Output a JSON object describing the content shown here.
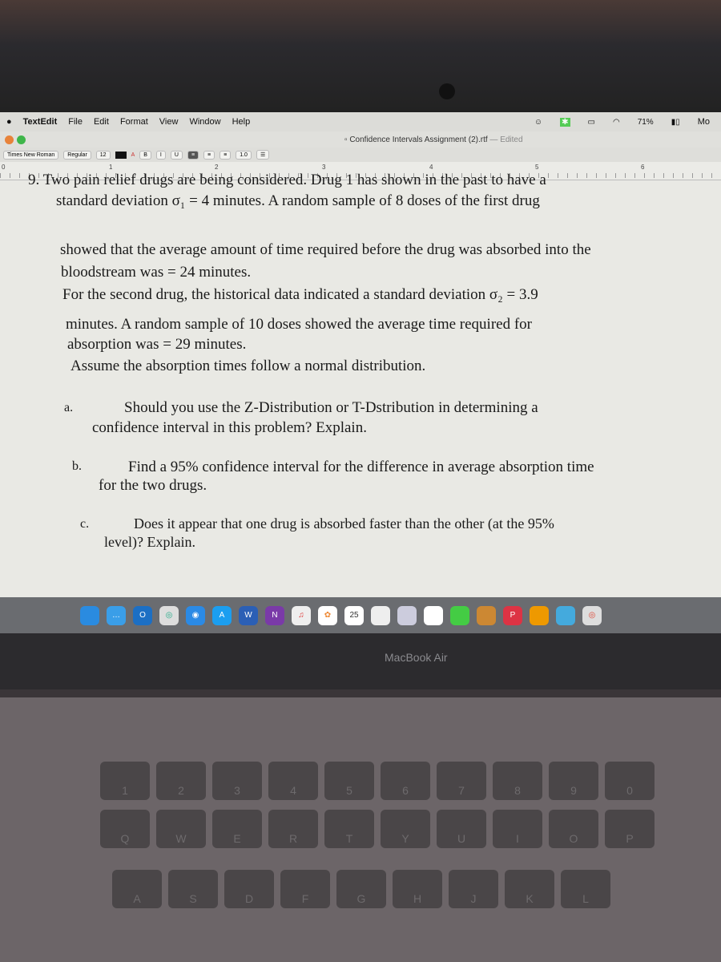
{
  "menubar": {
    "app": "TextEdit",
    "items": [
      "File",
      "Edit",
      "Format",
      "View",
      "Window",
      "Help"
    ],
    "battery": "71%",
    "clock_partial": "Mo"
  },
  "window": {
    "title": "Confidence Intervals Assignment (2).rtf",
    "edited": "— Edited"
  },
  "toolbar": {
    "font": "Times New Roman",
    "style": "Regular",
    "size": "12",
    "bold": "B",
    "italic": "I",
    "underline": "U",
    "spacing": "1.0"
  },
  "ruler": [
    "0",
    "1",
    "2",
    "3",
    "4",
    "5",
    "6"
  ],
  "document": {
    "lines": [
      "9. Two pain relief drugs are being considered. Drug 1 has shown in the past to have a",
      "standard deviation σ₁ = 4 minutes. A random sample of 8 doses of the first drug",
      "showed that the average amount of time required before the drug was absorbed into the",
      "bloodstream was = 24 minutes.",
      "For the second drug, the historical data indicated a standard deviation σ₂ = 3.9",
      "minutes. A random sample of 10 doses showed the average time required for",
      "absorption was = 29 minutes.",
      "Assume the absorption times follow a normal distribution."
    ],
    "questions": [
      {
        "label": "a.",
        "line1": "Should you use the Z-Distribution or T-Dstribution in determining a",
        "line2": "confidence interval in this problem? Explain."
      },
      {
        "label": "b.",
        "line1": "Find a 95% confidence interval for the difference in average absorption time",
        "line2": "for the two drugs."
      },
      {
        "label": "c.",
        "line1": "Does it appear that one drug is absorbed faster than the other (at the 95%",
        "line2": "level)? Explain."
      }
    ]
  },
  "dock": {
    "calendar_day": "25",
    "icons": [
      "finder",
      "messages",
      "outlook",
      "chrome",
      "safari",
      "appstore",
      "word",
      "onenote",
      "itunes",
      "photos",
      "calendar",
      "notes",
      "preview",
      "facetime",
      "books",
      "powerpoint",
      "reading",
      "mail",
      "photo-booth",
      "chrome2"
    ]
  },
  "device_label": "MacBook Air",
  "keyboard": {
    "numbers": [
      "1",
      "2",
      "3",
      "4",
      "5",
      "6",
      "7",
      "8",
      "9",
      "0"
    ],
    "row1": [
      "Q",
      "W",
      "E",
      "R",
      "T",
      "Y",
      "U",
      "I",
      "O",
      "P"
    ],
    "row2": [
      "A",
      "S",
      "D",
      "F",
      "G",
      "H",
      "J",
      "K",
      "L"
    ]
  }
}
